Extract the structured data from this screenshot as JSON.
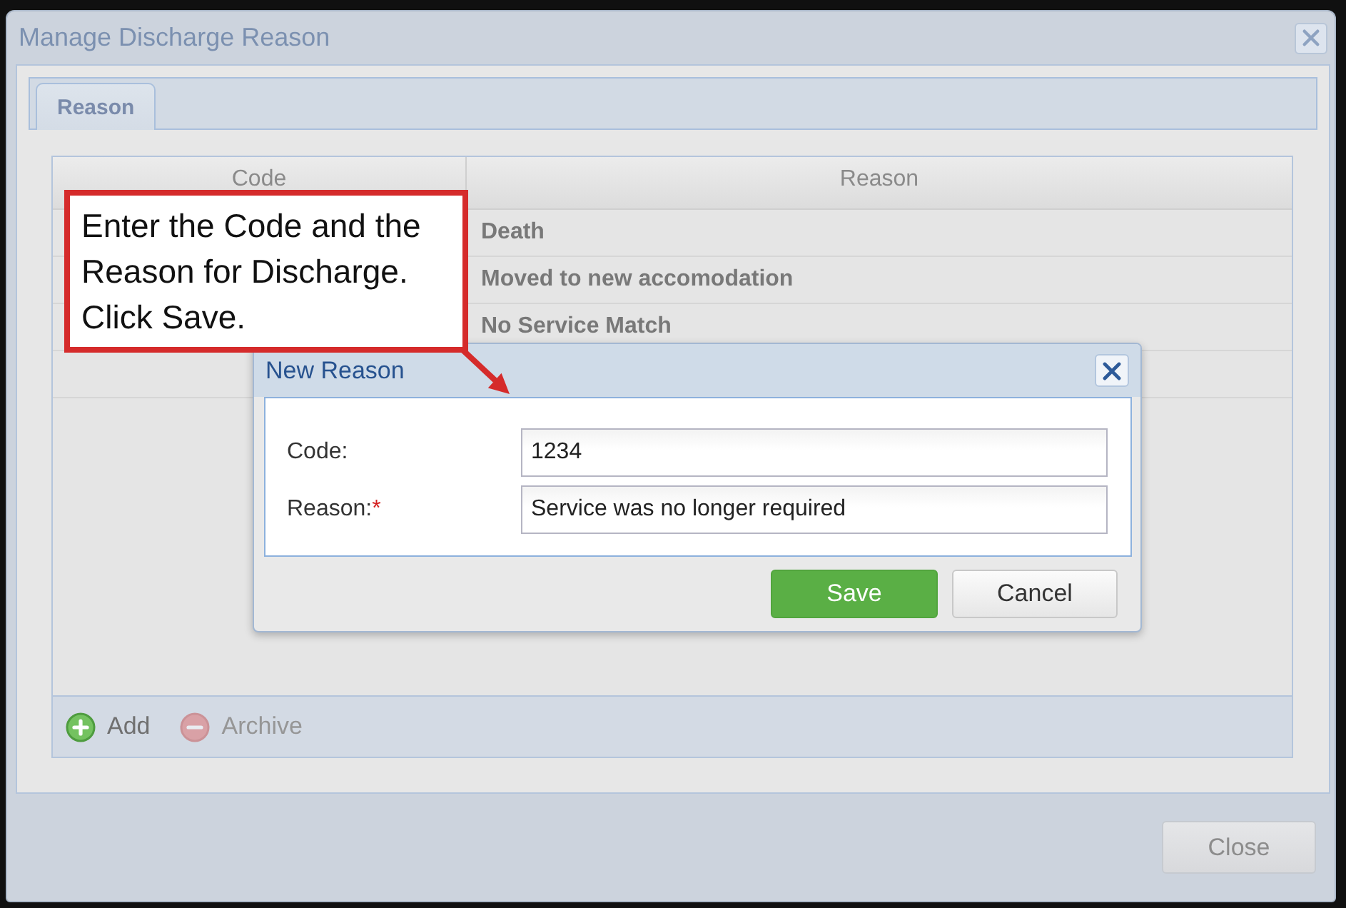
{
  "window": {
    "title": "Manage Discharge Reason"
  },
  "tabs": [
    {
      "label": "Reason",
      "selected": true
    }
  ],
  "grid": {
    "columns": [
      "Code",
      "Reason"
    ],
    "rows": [
      {
        "reason": "Death"
      },
      {
        "reason": "Moved to new accomodation"
      },
      {
        "reason": "No Service Match"
      }
    ]
  },
  "toolbar": [
    {
      "kind": "add",
      "label": "Add",
      "disabled": false
    },
    {
      "kind": "archive",
      "label": "Archive",
      "disabled": true
    }
  ],
  "footer_buttons": [
    {
      "label": "Close"
    }
  ],
  "dialog": {
    "title": "New Reason",
    "fields": [
      {
        "label": "Code:",
        "value": "1234"
      },
      {
        "label": "Reason:",
        "required_mark": "*",
        "value": "Service was no longer required"
      }
    ],
    "buttons": [
      {
        "kind": "primary",
        "label": "Save"
      },
      {
        "kind": "secondary",
        "label": "Cancel"
      }
    ]
  },
  "callout": {
    "text": "Enter the Code and the Reason for Discharge. Click Save."
  }
}
